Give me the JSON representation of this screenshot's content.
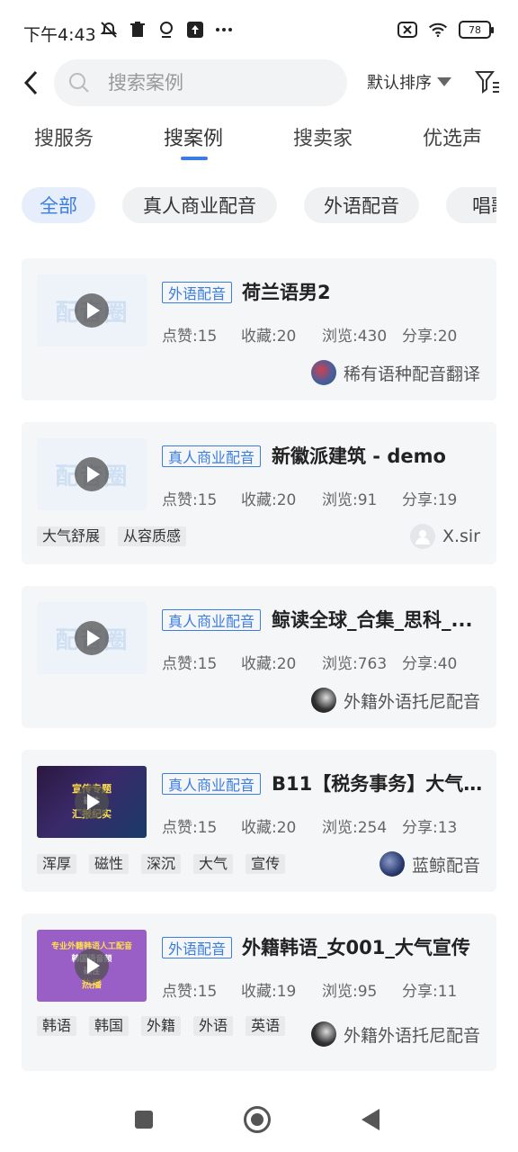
{
  "status_bar": {
    "time": "下午4:43",
    "battery": "78"
  },
  "search": {
    "placeholder": "搜索案例",
    "sort_label": "默认排序"
  },
  "tabs": [
    {
      "label": "搜服务"
    },
    {
      "label": "搜案例"
    },
    {
      "label": "搜卖家"
    },
    {
      "label": "优选声"
    }
  ],
  "chips": [
    {
      "label": "全部"
    },
    {
      "label": "真人商业配音"
    },
    {
      "label": "外语配音"
    },
    {
      "label": "唱歌"
    }
  ],
  "cards": [
    {
      "category": "外语配音",
      "title": "荷兰语男2",
      "likes": "点赞:15",
      "favorites": "收藏:20",
      "views": "浏览:430",
      "shares": "分享:20",
      "author": "稀有语种配音翻译",
      "thumb_watermark": "配音圈"
    },
    {
      "category": "真人商业配音",
      "title": "新徽派建筑 - demo",
      "likes": "点赞:15",
      "favorites": "收藏:20",
      "views": "浏览:91",
      "shares": "分享:19",
      "tags": [
        "大气舒展",
        "从容质感"
      ],
      "author": "X.sir",
      "thumb_watermark": "配音圈"
    },
    {
      "category": "真人商业配音",
      "title": "鲸读全球_合集_思科_...",
      "likes": "点赞:15",
      "favorites": "收藏:20",
      "views": "浏览:763",
      "shares": "分享:40",
      "author": "外籍外语托尼配音",
      "thumb_watermark": "配音圈"
    },
    {
      "category": "真人商业配音",
      "title": "B11【税务事务】大气...",
      "likes": "点赞:15",
      "favorites": "收藏:20",
      "views": "浏览:254",
      "shares": "分享:13",
      "tags": [
        "浑厚",
        "磁性",
        "深沉",
        "大气",
        "宣传"
      ],
      "author": "蓝鲸配音",
      "thumb_text": [
        "宣传专题",
        "磁性",
        "汇报纪实"
      ]
    },
    {
      "category": "外语配音",
      "title": "外籍韩语_女001_大气宣传",
      "likes": "点赞:15",
      "favorites": "收藏:19",
      "views": "浏览:95",
      "shares": "分享:11",
      "tags": [
        "韩语",
        "韩国",
        "外籍",
        "外语",
        "英语"
      ],
      "author": "外籍外语托尼配音",
      "thumb_text": [
        "专业外籍韩语人工配音",
        "韩国语音频",
        "磁性",
        "热播"
      ]
    }
  ],
  "colors": {
    "accent": "#3b7de0",
    "card_bg": "#f5f6f8",
    "chip_bg": "#f0f1f3"
  }
}
